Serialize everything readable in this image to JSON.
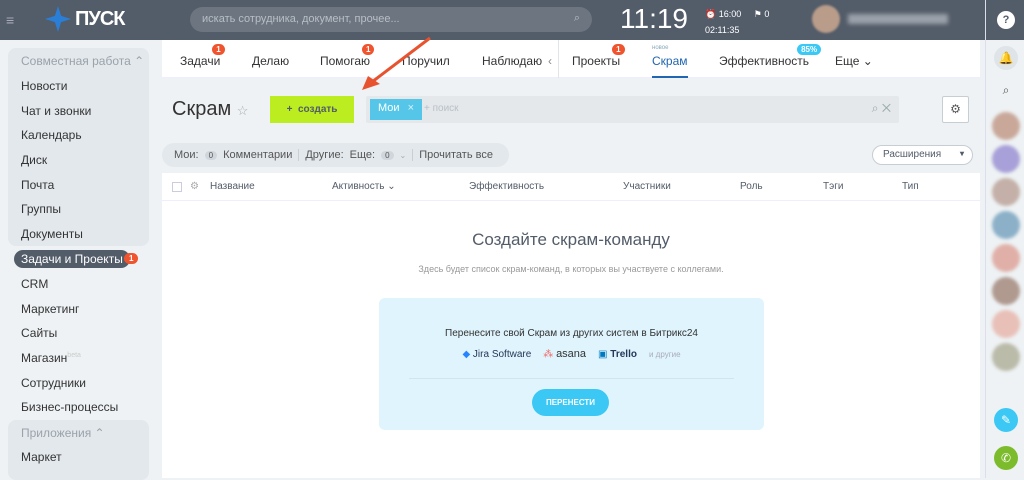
{
  "header": {
    "logo": "ПУСК",
    "search_placeholder": "искать сотрудника, документ, прочее...",
    "time": "11:19",
    "alarm": "16:00",
    "flags": "0",
    "timer": "02:11:35",
    "help": "?"
  },
  "sidebar": {
    "group1": "Совместная работа ⌃",
    "items": [
      "Новости",
      "Чат и звонки",
      "Календарь",
      "Диск",
      "Почта",
      "Группы",
      "Документы"
    ],
    "active": "Задачи и Проекты",
    "active_count": "1",
    "items2": [
      "CRM",
      "Маркетинг",
      "Сайты",
      "Магазин",
      "Сотрудники",
      "Бизнес-процессы"
    ],
    "beta": "beta",
    "group2": "Приложения ⌃",
    "items3": [
      "Маркет"
    ]
  },
  "tabs": {
    "items": [
      {
        "label": "Задачи",
        "count": "1"
      },
      {
        "label": "Делаю"
      },
      {
        "label": "Помогаю",
        "count": "1"
      },
      {
        "label": "Поручил"
      },
      {
        "label": "Наблюдаю"
      },
      {
        "label": "Проекты",
        "count": "1"
      },
      {
        "label": "Скрам",
        "tag": "новое"
      },
      {
        "label": "Эффективность",
        "badge": "85%"
      },
      {
        "label": "Еще ⌄"
      }
    ],
    "collapse": "‹"
  },
  "toolbar": {
    "title": "Скрам",
    "create_label": "создать",
    "chip": "Мои",
    "search_placeholder": "+ поиск"
  },
  "counters": {
    "my": "Мои:",
    "my_count": "0",
    "comments": "Комментарии",
    "others": "Другие:",
    "more": "Еще:",
    "more_count": "0",
    "read_all": "Прочитать все",
    "extensions": "Расширения"
  },
  "table": {
    "columns": [
      "Название",
      "Активность ⌄",
      "Эффективность",
      "Участники",
      "Роль",
      "Тэги",
      "Тип"
    ]
  },
  "empty": {
    "title": "Создайте скрам-команду",
    "subtitle": "Здесь будет список скрам-команд, в которых вы участвуете с коллегами.",
    "migrate_text": "Перенесите свой Скрам из других систем в Битрикс24",
    "logos": [
      "Jira Software",
      "asana",
      "Trello"
    ],
    "others": "и другие",
    "button": "ПЕРЕНЕСТИ"
  },
  "colors": {
    "accent": "#bbed21",
    "primary": "#3bc8f5",
    "topbar": "#535c69",
    "badge": "#f0542e",
    "arrow": "#e8532f"
  }
}
